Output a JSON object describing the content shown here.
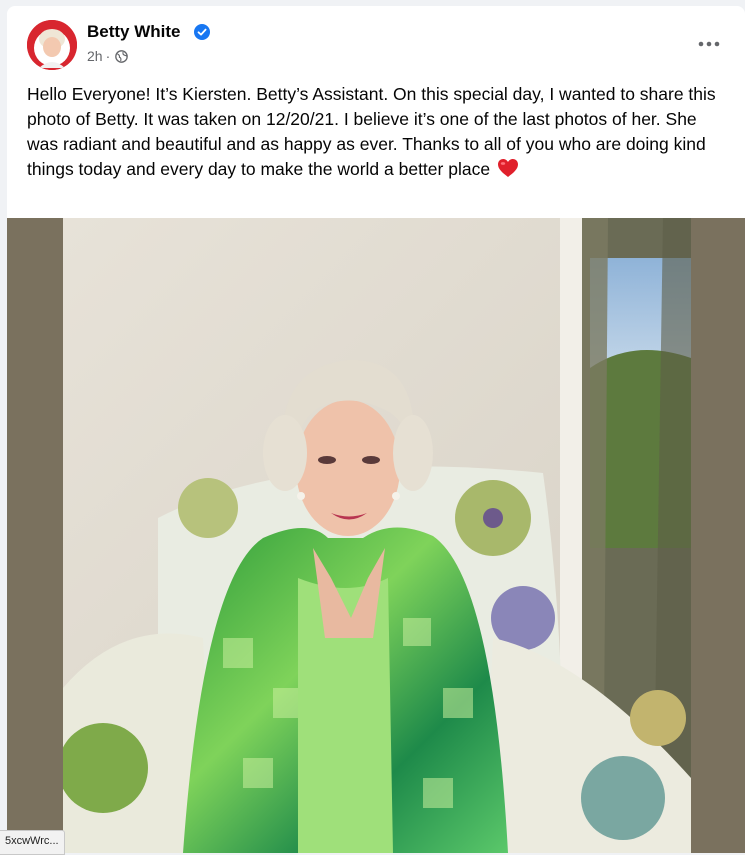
{
  "post": {
    "author": "Betty White",
    "verified_icon": "verified-badge-icon",
    "time": "2h",
    "separator": "·",
    "audience_icon": "globe-icon",
    "more_icon": "more-options-icon",
    "text": "Hello Everyone!  It’s Kiersten.  Betty’s Assistant.  On this special day, I wanted to share this photo of Betty.  It was taken on 12/20/21.  I believe it’s one of the last photos of her.  She was radiant and beautiful and as happy as ever.  Thanks to all of you who are doing kind things today and every day to make the world a better place",
    "emoji": "red-heart-icon"
  },
  "colors": {
    "verified": "#1877f2",
    "meta_text": "#65676b",
    "photo_background": "#7a715e",
    "heart": "#e0202b"
  },
  "status_bar": {
    "url_fragment": "5xcwWrc..."
  }
}
